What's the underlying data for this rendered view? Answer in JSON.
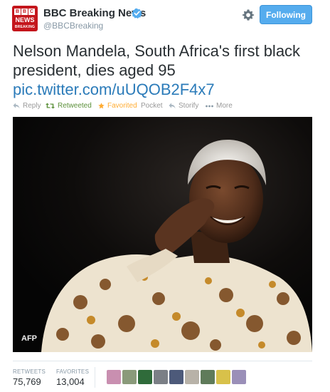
{
  "account": {
    "avatar_text": "BBC NEWS BREAKING",
    "avatar_letters": [
      "B",
      "B",
      "C"
    ],
    "avatar_news": "NEWS",
    "avatar_breaking": "BREAKING",
    "display_name": "BBC Breaking News",
    "handle": "@BBCBreaking",
    "verified": true
  },
  "header": {
    "follow_label": "Following",
    "icons": [
      "gear-icon",
      "verified-icon"
    ]
  },
  "tweet": {
    "text": "Nelson Mandela, South Africa's first black president, dies aged 95",
    "link": "pic.twitter.com/uUQOB2F4x7"
  },
  "actions": {
    "reply": "Reply",
    "retweeted": "Retweeted",
    "favorited": "Favorited",
    "pocket": "Pocket",
    "storify": "Storify",
    "more": "More"
  },
  "photo": {
    "credit": "AFP"
  },
  "stats": {
    "retweets_label": "RETWEETS",
    "retweets_value": "75,769",
    "favorites_label": "FAVORITES",
    "favorites_value": "13,004",
    "favoriter_avatar_count": 9
  },
  "colors": {
    "accent": "#55acee",
    "link": "#2b7bb9",
    "retweet_green": "#5c913b",
    "favorite_orange": "#ffac33",
    "bbc_red": "#c4161c"
  }
}
